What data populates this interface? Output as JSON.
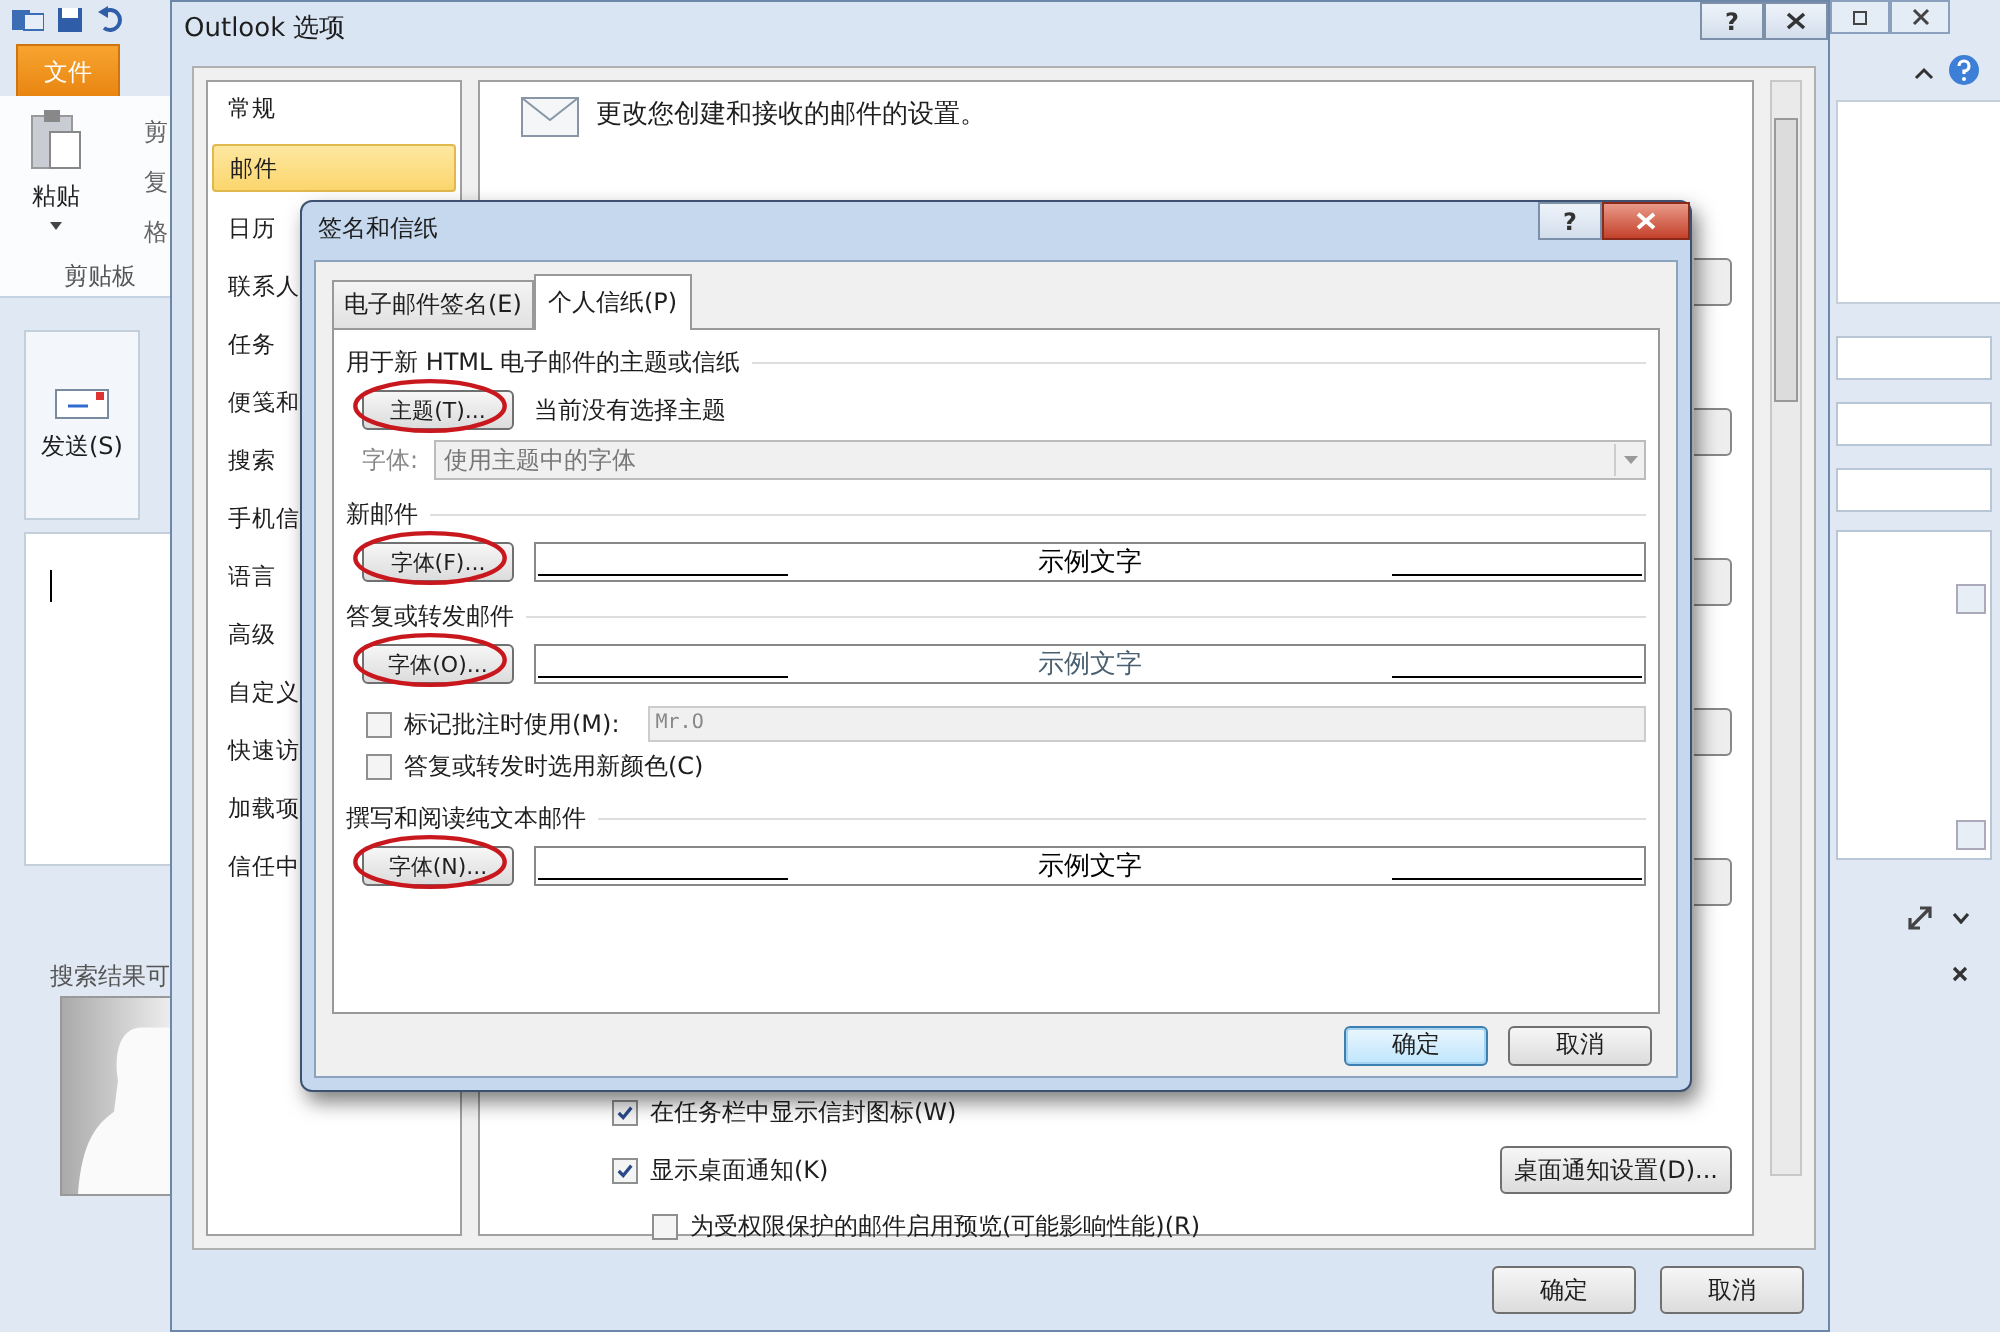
{
  "outlook": {
    "tabs": [
      {
        "label": "文件",
        "selected": true
      }
    ],
    "paste": "粘贴",
    "clipboard_items": [
      "剪",
      "复",
      "格"
    ],
    "clipboard_group": "剪贴板",
    "send": "发送(S)",
    "search_hint": "搜索结果可"
  },
  "options": {
    "title": "Outlook 选项",
    "help": "?",
    "nav": [
      {
        "label": "常规",
        "selected": false
      },
      {
        "label": "邮件",
        "selected": true
      },
      {
        "label": "日历",
        "selected": false
      },
      {
        "label": "联系人",
        "selected": false
      },
      {
        "label": "任务",
        "selected": false
      },
      {
        "label": "便笺和",
        "selected": false
      },
      {
        "label": "搜索",
        "selected": false
      },
      {
        "label": "手机信",
        "selected": false
      },
      {
        "label": "语言",
        "selected": false
      },
      {
        "label": "高级",
        "selected": false
      },
      {
        "label": "自定义",
        "selected": false
      },
      {
        "label": "快速访",
        "selected": false
      },
      {
        "label": "加载项",
        "selected": false
      },
      {
        "label": "信任中",
        "selected": false
      }
    ],
    "header": "更改您创建和接收的邮件的设置。",
    "checks": [
      {
        "label": "在任务栏中显示信封图标(W)",
        "checked": true
      },
      {
        "label": "显示桌面通知(K)",
        "checked": true,
        "children": [
          {
            "label": "为受权限保护的邮件启用预览(可能影响性能)(R)",
            "checked": false
          }
        ]
      }
    ],
    "notify_button": "桌面通知设置(D)...",
    "buttons": [
      "确定",
      "取消"
    ]
  },
  "dialog": {
    "title": "签名和信纸",
    "help": "?",
    "tabs": [
      {
        "label": "电子邮件签名(E)",
        "selected": false
      },
      {
        "label": "个人信纸(P)",
        "selected": true
      }
    ],
    "theme": {
      "heading": "用于新 HTML 电子邮件的主题或信纸",
      "button": "主题(T)...",
      "circled": true,
      "status": "当前没有选择主题",
      "font_label": "字体:",
      "font_value": "使用主题中的字体",
      "disabled": true
    },
    "sections": [
      {
        "kind": "font",
        "heading": "新邮件",
        "button": "字体(F)...",
        "circled": true,
        "sample": "示例文字",
        "color": "#000000"
      },
      {
        "kind": "font",
        "heading": "答复或转发邮件",
        "button": "字体(O)...",
        "circled": true,
        "sample": "示例文字",
        "color": "#4a6070"
      },
      {
        "kind": "options",
        "items": [
          {
            "kind": "field-check",
            "label": "标记批注时使用(M):",
            "checked": false,
            "value": "Mr.O"
          },
          {
            "kind": "check",
            "label": "答复或转发时选用新颜色(C)",
            "checked": false
          }
        ]
      },
      {
        "kind": "font",
        "heading": "撰写和阅读纯文本邮件",
        "button": "字体(N)...",
        "circled": true,
        "sample": "示例文字",
        "color": "#000000"
      }
    ],
    "buttons": [
      {
        "label": "确定",
        "selected": true
      },
      {
        "label": "取消",
        "selected": false
      }
    ]
  }
}
